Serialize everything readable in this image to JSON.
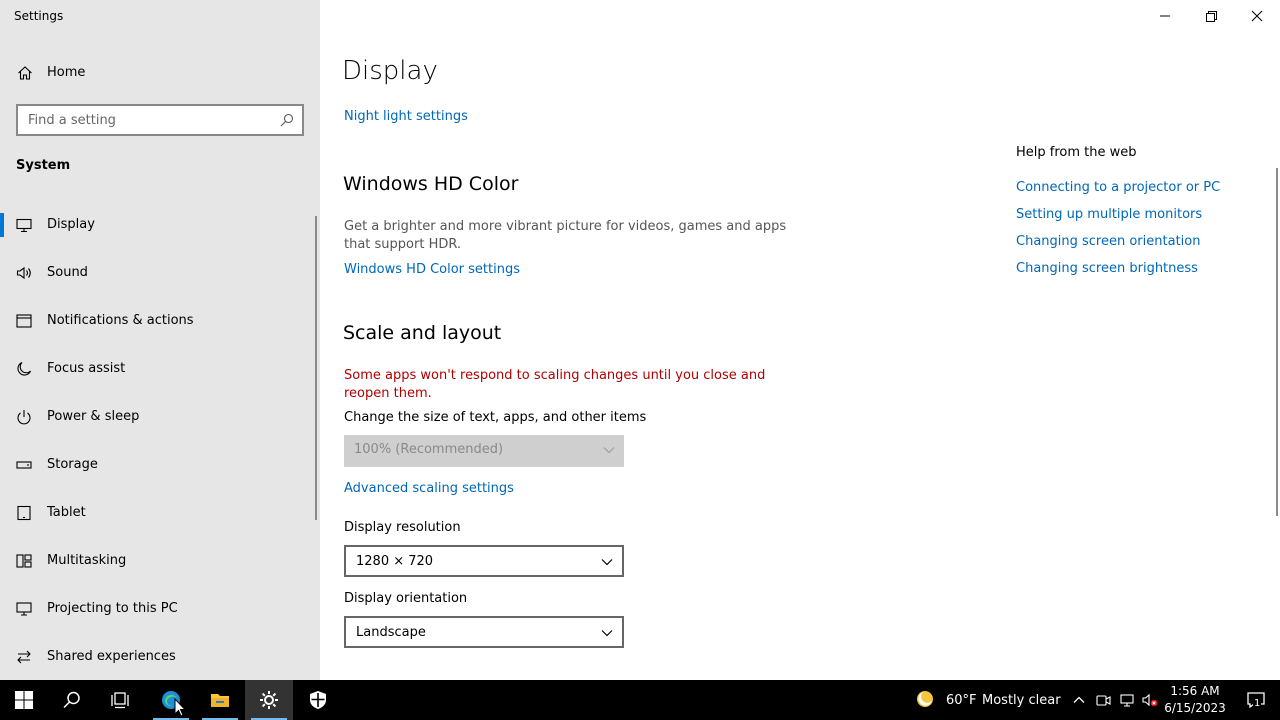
{
  "window": {
    "title": "Settings"
  },
  "sidebar": {
    "home_label": "Home",
    "search_placeholder": "Find a setting",
    "section_title": "System",
    "items": [
      {
        "label": "Display",
        "icon": "monitor-icon",
        "active": true
      },
      {
        "label": "Sound",
        "icon": "speaker-icon"
      },
      {
        "label": "Notifications & actions",
        "icon": "notifications-icon"
      },
      {
        "label": "Focus assist",
        "icon": "moon-icon"
      },
      {
        "label": "Power & sleep",
        "icon": "power-icon"
      },
      {
        "label": "Storage",
        "icon": "storage-icon"
      },
      {
        "label": "Tablet",
        "icon": "tablet-icon"
      },
      {
        "label": "Multitasking",
        "icon": "multitasking-icon"
      },
      {
        "label": "Projecting to this PC",
        "icon": "projecting-icon"
      },
      {
        "label": "Shared experiences",
        "icon": "shared-experiences-icon"
      }
    ]
  },
  "main": {
    "page_title": "Display",
    "night_light_link": "Night light settings",
    "hd_color": {
      "heading": "Windows HD Color",
      "description": "Get a brighter and more vibrant picture for videos, games and apps that support HDR.",
      "link": "Windows HD Color settings"
    },
    "scale_layout": {
      "heading": "Scale and layout",
      "warning": "Some apps won't respond to scaling changes until you close and reopen them.",
      "size_label": "Change the size of text, apps, and other items",
      "size_value": "100% (Recommended)",
      "advanced_link": "Advanced scaling settings",
      "resolution_label": "Display resolution",
      "resolution_value": "1280 × 720",
      "orientation_label": "Display orientation",
      "orientation_value": "Landscape"
    },
    "help": {
      "title": "Help from the web",
      "links": [
        "Connecting to a projector or PC",
        "Setting up multiple monitors",
        "Changing screen orientation",
        "Changing screen brightness"
      ]
    }
  },
  "taskbar": {
    "weather_temp": "60°F",
    "weather_desc": "Mostly clear",
    "time": "1:56 AM",
    "date": "6/15/2023",
    "notification_count": "1"
  },
  "colors": {
    "accent": "#0078d7",
    "link": "#0067b8",
    "warning": "#b00000",
    "sidebar_bg": "#e6e6e6"
  }
}
